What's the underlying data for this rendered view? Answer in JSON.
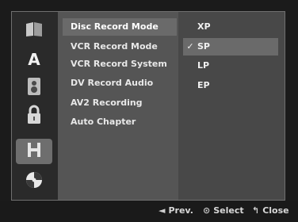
{
  "sidebar": {
    "icons": [
      {
        "name": "book-icon"
      },
      {
        "name": "letter-a-icon",
        "text": "A"
      },
      {
        "name": "speaker-icon"
      },
      {
        "name": "lock-icon"
      },
      {
        "name": "film-icon",
        "selected": true
      },
      {
        "name": "disc-icon"
      }
    ]
  },
  "menu": {
    "items": [
      {
        "label": "Disc Record Mode",
        "selected": true
      },
      {
        "label": "VCR Record Mode"
      },
      {
        "label": "VCR Record System"
      },
      {
        "label": "DV Record Audio"
      },
      {
        "label": "AV2 Recording"
      },
      {
        "label": "Auto Chapter"
      }
    ]
  },
  "options": {
    "items": [
      {
        "label": "XP",
        "checked": false
      },
      {
        "label": "SP",
        "checked": true,
        "check": "✓"
      },
      {
        "label": "LP",
        "checked": false
      },
      {
        "label": "EP",
        "checked": false
      }
    ]
  },
  "footer": {
    "prev": {
      "symbol": "◄",
      "label": "Prev."
    },
    "select": {
      "symbol": "⊙",
      "label": "Select"
    },
    "close": {
      "symbol": "↰",
      "label": "Close"
    }
  },
  "colors": {
    "panel": "#3a3a3a",
    "menu": "#555555",
    "highlight": "#6a6a6a"
  }
}
